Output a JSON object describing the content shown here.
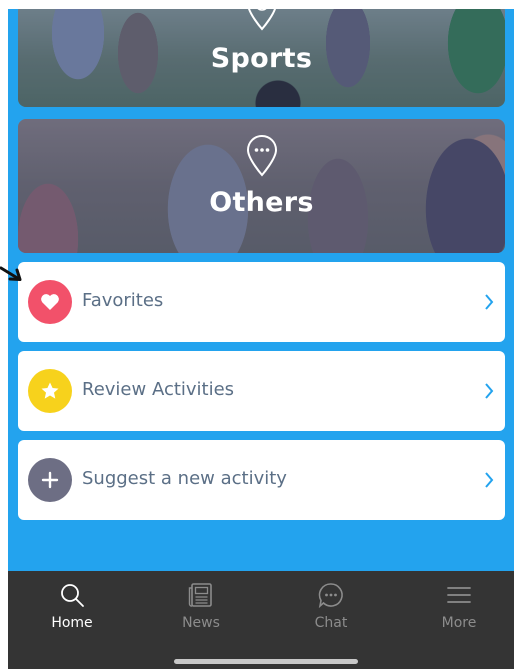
{
  "categories": [
    {
      "label": "Sports",
      "icon": "soccer-ball-pin-icon"
    },
    {
      "label": "Others",
      "icon": "ellipsis-pin-icon"
    }
  ],
  "list": [
    {
      "label": "Favorites",
      "icon": "heart-icon",
      "icon_color": "#f2516a"
    },
    {
      "label": "Review Activities",
      "icon": "star-icon",
      "icon_color": "#f7d21c"
    },
    {
      "label": "Suggest a new activity",
      "icon": "plus-icon",
      "icon_color": "#6d6e84"
    }
  ],
  "tabs": [
    {
      "label": "Home",
      "icon": "search-icon",
      "active": true
    },
    {
      "label": "News",
      "icon": "newspaper-icon",
      "active": false
    },
    {
      "label": "Chat",
      "icon": "chat-bubble-icon",
      "active": false
    },
    {
      "label": "More",
      "icon": "hamburger-menu-icon",
      "active": false
    }
  ],
  "colors": {
    "background": "#23a3ee",
    "tab_bar": "#343434",
    "row_text": "#5b6f86",
    "chevron": "#23a3ee",
    "tab_active": "#ffffff",
    "tab_inactive": "#8c8c8c"
  }
}
